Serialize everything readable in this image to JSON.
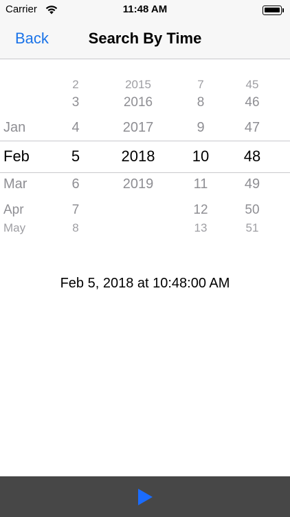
{
  "status_bar": {
    "carrier": "Carrier",
    "time": "11:48 AM",
    "icons": [
      "wifi-icon",
      "battery-icon"
    ]
  },
  "nav": {
    "back_label": "Back",
    "title": "Search By Time",
    "accent_color": "#1a73e8"
  },
  "picker": {
    "columns": [
      {
        "name": "month",
        "items": [
          "Jan",
          "Feb",
          "Mar",
          "Apr",
          "May"
        ],
        "selected": "Feb"
      },
      {
        "name": "day",
        "items": [
          "2",
          "3",
          "4",
          "5",
          "6",
          "7",
          "8"
        ],
        "selected": "5"
      },
      {
        "name": "year",
        "items": [
          "2015",
          "2016",
          "2017",
          "2018",
          "2019"
        ],
        "selected": "2018"
      },
      {
        "name": "hour",
        "items": [
          "7",
          "8",
          "9",
          "10",
          "11",
          "12",
          "13"
        ],
        "selected": "10"
      },
      {
        "name": "minute",
        "items": [
          "45",
          "46",
          "47",
          "48",
          "49",
          "50",
          "51"
        ],
        "selected": "48"
      }
    ]
  },
  "readout": "Feb 5, 2018 at 10:48:00 AM",
  "toolbar": {
    "play_icon": "play-icon",
    "play_color": "#1a6cff",
    "background": "#474747"
  }
}
